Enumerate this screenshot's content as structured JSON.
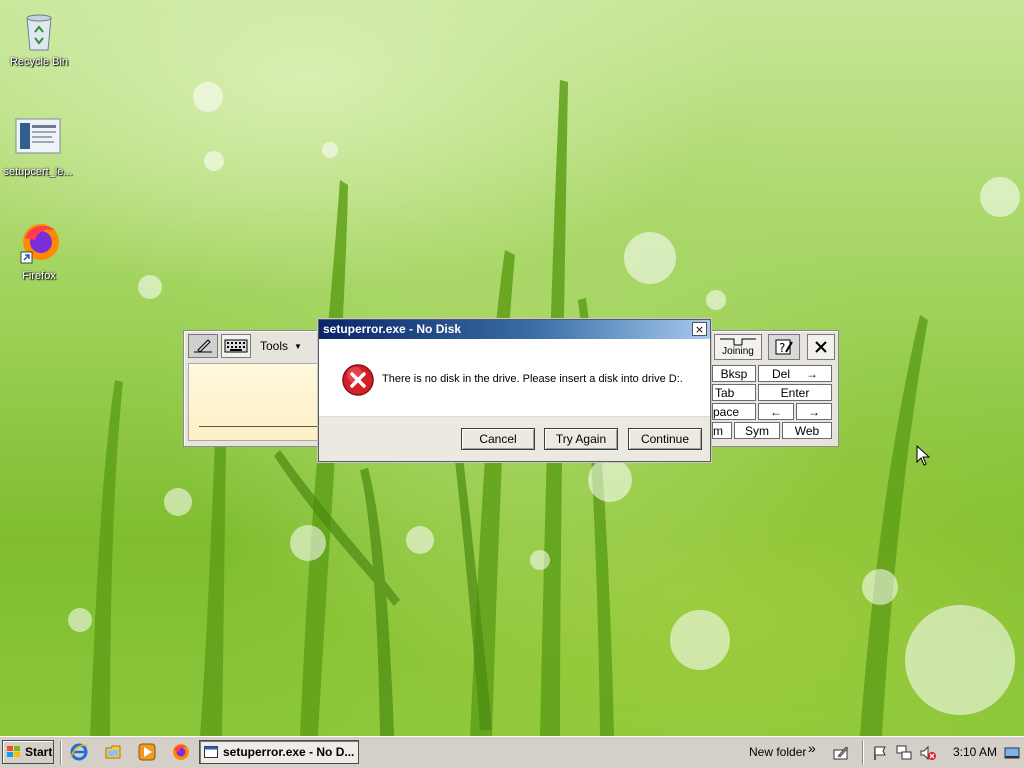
{
  "desktop": {
    "icons": [
      {
        "label": "Recycle Bin",
        "icon": "recycle-bin-icon"
      },
      {
        "label": "setupcert_le...",
        "icon": "document-icon"
      },
      {
        "label": "Firefox",
        "icon": "firefox-icon"
      }
    ]
  },
  "input_panel": {
    "tools_label": "Tools",
    "joining_label": "Joining",
    "keys": {
      "bksp": "Bksp",
      "del": "Del",
      "del_arrow": "→",
      "tab": "Tab",
      "enter": "Enter",
      "space": "pace",
      "left_arrow": "←",
      "right_arrow": "→",
      "num": "m",
      "sym": "Sym",
      "web": "Web"
    }
  },
  "dialog": {
    "title": "setuperror.exe - No Disk",
    "close": "×",
    "message": "There is no disk in the drive. Please insert a disk into drive D:.",
    "buttons": {
      "cancel": "Cancel",
      "try_again": "Try Again",
      "continue": "Continue"
    }
  },
  "taskbar": {
    "start_label": "Start",
    "active_task": "setuperror.exe - No D...",
    "toolbar_label": "New folder",
    "chevron": "»",
    "clock": "3:10 AM"
  }
}
